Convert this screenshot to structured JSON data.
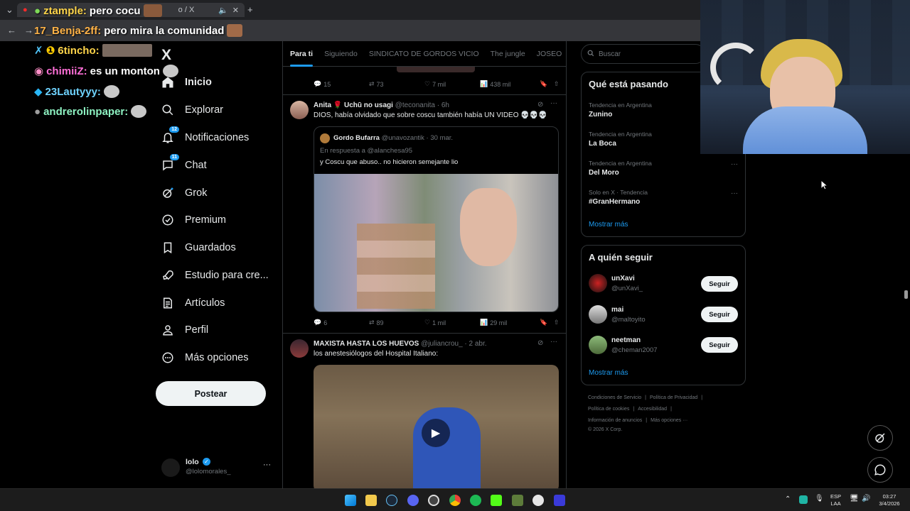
{
  "browser": {
    "tab_label": "o / X",
    "tab_close": "✕",
    "new_tab": "+",
    "address_overlay": "pero mira la comunidad"
  },
  "chat": [
    {
      "user": "ztample:",
      "message": "pero cocu"
    },
    {
      "user": "17_Benja-2ff:",
      "message": "pero mira la comunidad"
    },
    {
      "user": "6tincho:",
      "message": ""
    },
    {
      "user": "chimiiZ:",
      "message": "es un monton"
    },
    {
      "user": "23Lautyyy:",
      "message": ""
    },
    {
      "user": "andrerolinpaper:",
      "message": ""
    }
  ],
  "sidebar": {
    "logo": "X",
    "items": [
      {
        "label": "Inicio",
        "icon": "home-icon",
        "badge": ""
      },
      {
        "label": "Explorar",
        "icon": "search-icon",
        "badge": ""
      },
      {
        "label": "Notificaciones",
        "icon": "bell-icon",
        "badge": "12"
      },
      {
        "label": "Chat",
        "icon": "chat-icon",
        "badge": "11"
      },
      {
        "label": "Grok",
        "icon": "grok-icon",
        "badge": ""
      },
      {
        "label": "Premium",
        "icon": "premium-icon",
        "badge": ""
      },
      {
        "label": "Guardados",
        "icon": "bookmark-icon",
        "badge": ""
      },
      {
        "label": "Estudio para cre...",
        "icon": "rocket-icon",
        "badge": ""
      },
      {
        "label": "Artículos",
        "icon": "article-icon",
        "badge": ""
      },
      {
        "label": "Perfil",
        "icon": "person-icon",
        "badge": ""
      },
      {
        "label": "Más opciones",
        "icon": "more-circle-icon",
        "badge": ""
      }
    ],
    "post_button": "Postear",
    "account": {
      "name": "lolo",
      "handle": "@lolomorales_",
      "menu": "···"
    }
  },
  "feed": {
    "tabs": [
      "Para ti",
      "Siguiendo",
      "SINDICATO DE GORDOS VICIO",
      "The jungle",
      "JOSEO"
    ],
    "tweets": [
      {
        "stats": {
          "replies": "15",
          "retweets": "73",
          "likes": "7 mil",
          "views": "438 mil"
        }
      },
      {
        "name": "Anita 🌹 Uchū no usagi",
        "handle": "@teconanita · 6h",
        "text": "DIOS, había olvidado que sobre coscu también había UN VIDEO 💀💀💀",
        "quote": {
          "name": "Gordo Bufarra",
          "handle": "@unavozantik · 30 mar.",
          "reply_to": "En respuesta a @alanchesa95",
          "text": "y Coscu que abuso.. no hicieron semejante lio"
        },
        "stats": {
          "replies": "6",
          "retweets": "89",
          "likes": "1 mil",
          "views": "29 mil"
        }
      },
      {
        "name": "MAXISTA HASTA LOS HUEVOS",
        "handle": "@juliancrou_ · 2 abr.",
        "text": "los anestesiólogos del Hospital Italiano:"
      }
    ]
  },
  "right": {
    "search_placeholder": "Buscar",
    "trends_title": "Qué está pasando",
    "trends": [
      {
        "meta": "Tendencia en Argentina",
        "name": "Zunino"
      },
      {
        "meta": "Tendencia en Argentina",
        "name": "La Boca"
      },
      {
        "meta": "Tendencia en Argentina",
        "name": "Del Moro"
      },
      {
        "meta": "Solo en X · Tendencia",
        "name": "#GranHermano"
      }
    ],
    "show_more": "Mostrar más",
    "who_title": "A quién seguir",
    "who": [
      {
        "name": "unXavi",
        "handle": "@unXavi_",
        "button": "Seguir"
      },
      {
        "name": "mai",
        "handle": "@maltoyito",
        "button": "Seguir"
      },
      {
        "name": "neetman",
        "handle": "@cheman2007",
        "button": "Seguir"
      }
    ],
    "who_show_more": "Mostrar más",
    "footer": [
      [
        "Condiciones de Servicio",
        "Política de Privacidad"
      ],
      [
        "Política de cookies",
        "Accesibilidad"
      ],
      [
        "Información de anuncios",
        "Más opciones ···"
      ],
      [
        "© 2026 X Corp."
      ]
    ]
  },
  "taskbar": {
    "lang1": "ESP",
    "lang2": "LAA",
    "time": "03:27",
    "date": "3/4/2026"
  },
  "colors": {
    "accent": "#1d9bf0",
    "background": "#000000",
    "border": "#2f3336"
  }
}
